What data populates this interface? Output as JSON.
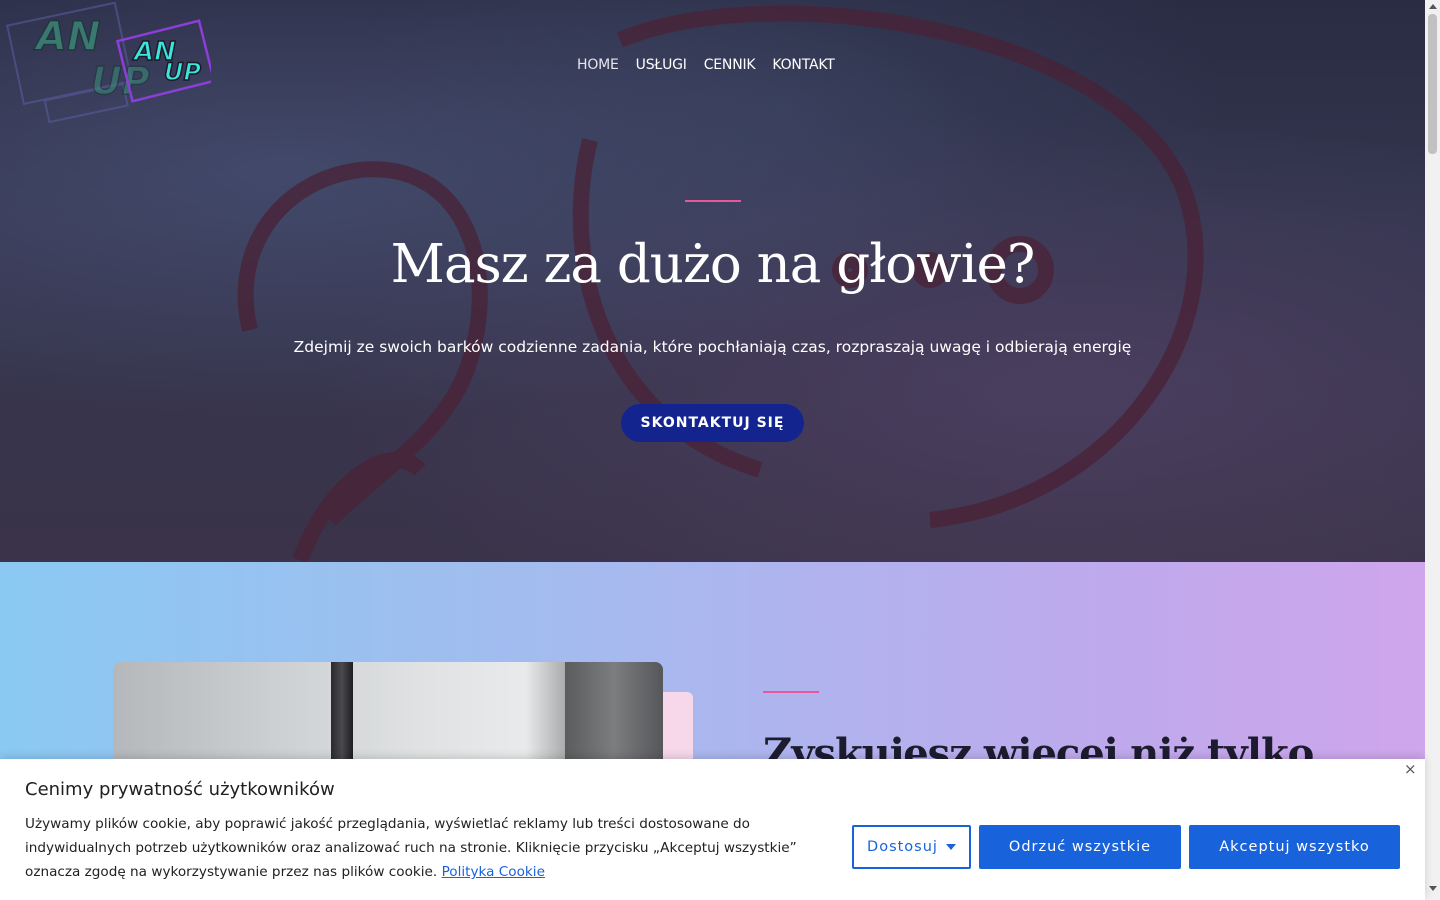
{
  "brand": {
    "logo_text_back": "AN",
    "logo_text_front_1": "AN",
    "logo_text_front_2": "UP",
    "logo_text_back_2": "UP"
  },
  "nav": {
    "items": [
      "HOME",
      "USŁUGI",
      "CENNIK",
      "KONTAKT"
    ],
    "active": "HOME"
  },
  "hero": {
    "title": "Masz za dużo na głowie?",
    "subtitle": "Zdejmij ze swoich barków codzienne zadania, które pochłaniają czas, rozpraszają uwagę i odbierają energię",
    "cta_label": "SKONTAKTUJ SIĘ"
  },
  "section2": {
    "title": "Zyskujesz więcej niż tylko"
  },
  "cookie": {
    "title": "Cenimy prywatność użytkowników",
    "text": "Używamy plików cookie, aby poprawić jakość przeglądania, wyświetlać reklamy lub treści dostosowane do indywidualnych potrzeb użytkowników oraz analizować ruch na stronie. Kliknięcie przycisku „Akceptuj wszystkie” oznacza zgodę na wykorzystywanie przez nas plików cookie.",
    "policy_link": "Polityka Cookie",
    "close_icon": "×",
    "customize_label": "Dostosuj",
    "reject_label": "Odrzuć wszystkie",
    "accept_label": "Akceptuj wszystko"
  },
  "colors": {
    "accent_pink": "#e7579c",
    "cta_blue": "#13248f",
    "cookie_blue": "#1863dc"
  }
}
